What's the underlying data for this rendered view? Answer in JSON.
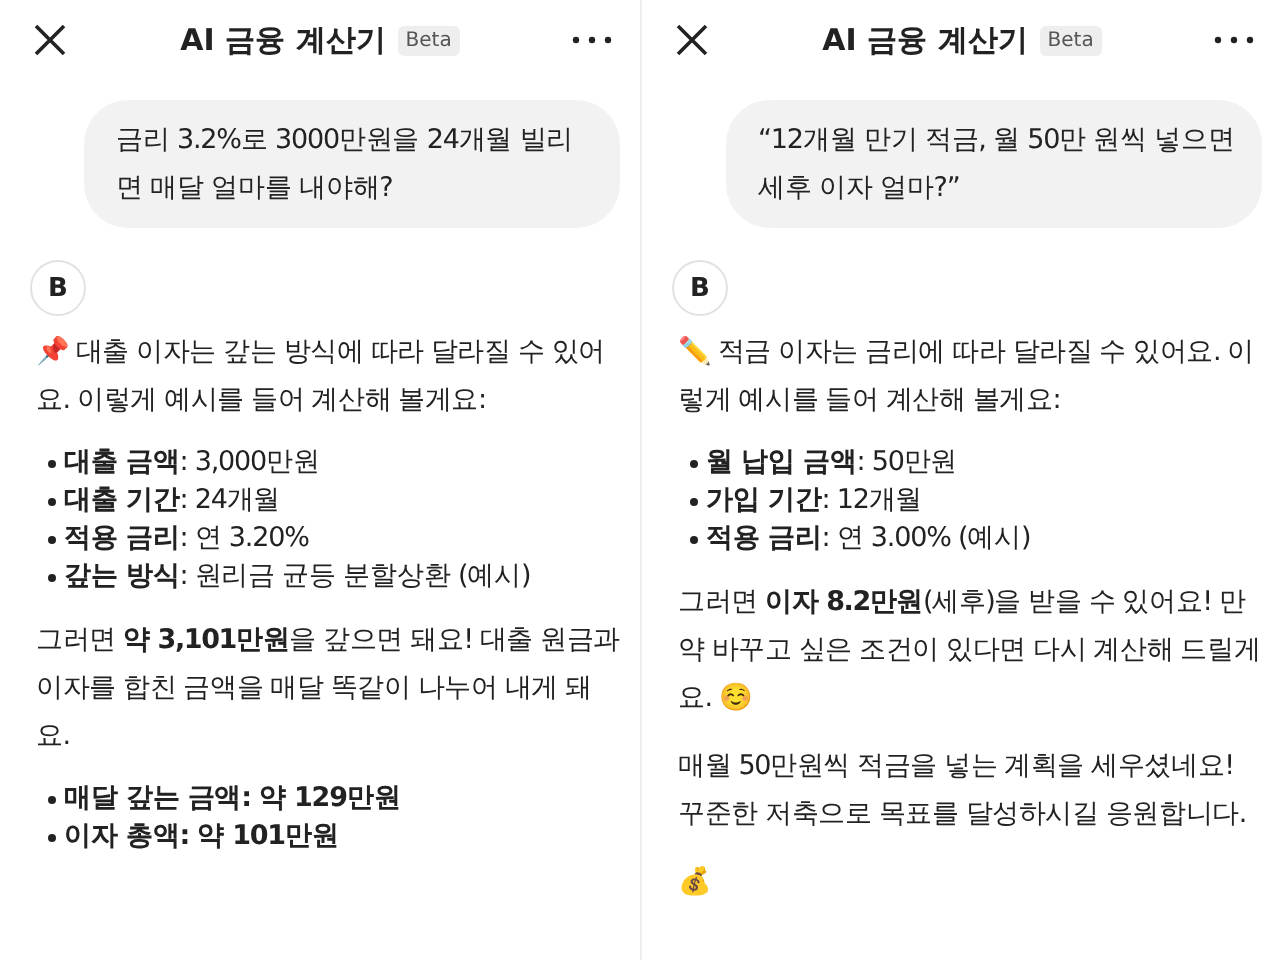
{
  "panels": [
    {
      "header": {
        "title": "AI 금융 계산기",
        "badge": "Beta"
      },
      "user_message": "금리 3.2%로 3000만원을 24개월 빌리면 매달 얼마를 내야해?",
      "bot_avatar": "B",
      "blocks": [
        {
          "kind": "text",
          "text": "📌 대출 이자는 갚는 방식에 따라 달라질 수 있어요. 이렇게 예시를 들어 계산해 볼게요:"
        },
        {
          "kind": "bullets",
          "items": [
            {
              "text": "**대출 금액**: 3,000만원",
              "strong": false
            },
            {
              "text": "**대출 기간**: 24개월",
              "strong": false
            },
            {
              "text": "**적용 금리**: 연 3.20%",
              "strong": false
            },
            {
              "text": "**갚는 방식**: 원리금 균등 분할상환 (예시)",
              "strong": false
            }
          ]
        },
        {
          "kind": "text",
          "text": "그러면 **약 3,101만원**을 갚으면 돼요! 대출 원금과 이자를 합친 금액을 매달 똑같이 나누어 내게 돼요."
        },
        {
          "kind": "bullets",
          "items": [
            {
              "text": "매달 갚는 금액: 약 129만원",
              "strong": true
            },
            {
              "text": "이자 총액: 약 101만원",
              "strong": true
            }
          ]
        }
      ]
    },
    {
      "header": {
        "title": "AI 금융 계산기",
        "badge": "Beta"
      },
      "user_message": "“12개월 만기 적금, 월 50만 원씩 넣으면 세후 이자 얼마?”",
      "bot_avatar": "B",
      "blocks": [
        {
          "kind": "text",
          "text": "✏️ 적금 이자는 금리에 따라 달라질 수 있어요. 이렇게 예시를 들어 계산해 볼게요:"
        },
        {
          "kind": "bullets",
          "items": [
            {
              "text": "**월 납입 금액**: 50만원",
              "strong": false
            },
            {
              "text": "**가입 기간**: 12개월",
              "strong": false
            },
            {
              "text": "**적용 금리**: 연 3.00% (예시)",
              "strong": false
            }
          ]
        },
        {
          "kind": "text",
          "text": "그러면 **이자 8.2만원**(세후)을 받을 수 있어요! 만약 바꾸고 싶은 조건이 있다면 다시 계산해 드릴게요. ☺️"
        },
        {
          "kind": "text",
          "text": "매월 50만원씩 적금을 넣는 계획을 세우셨네요! 꾸준한 저축으로 목표를 달성하시길 응원합니다."
        },
        {
          "kind": "text",
          "text": "💰"
        }
      ]
    }
  ]
}
